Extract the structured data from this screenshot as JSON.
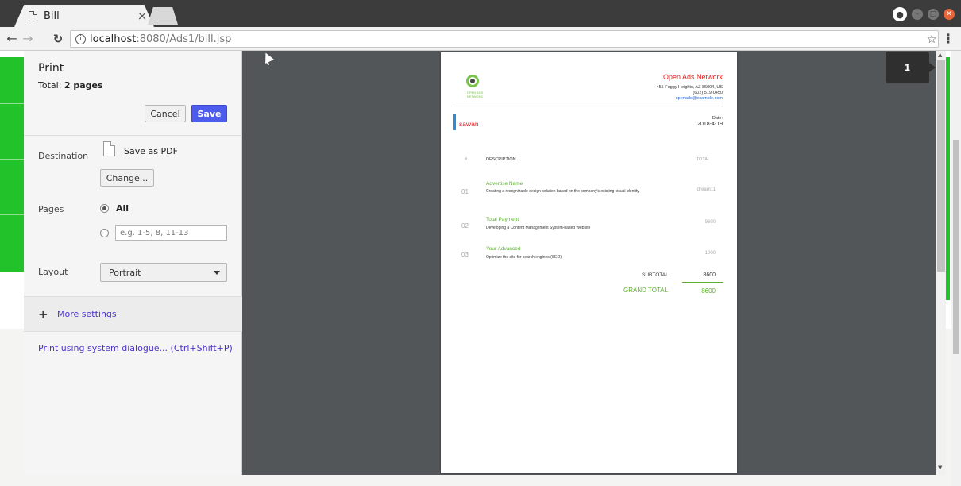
{
  "browser": {
    "tab_title": "Bill",
    "tab_close": "×",
    "url_host": "localhost",
    "url_path": ":8080/Ads1/bill.jsp"
  },
  "print": {
    "title": "Print",
    "total_label": "Total: ",
    "total_value": "2 pages",
    "cancel_label": "Cancel",
    "save_label": "Save",
    "destination_label": "Destination",
    "destination_value": "Save as PDF",
    "change_label": "Change...",
    "pages_label": "Pages",
    "pages_all": "All",
    "pages_placeholder": "e.g. 1-5, 8, 11-13",
    "layout_label": "Layout",
    "layout_value": "Portrait",
    "more_settings": "More settings",
    "system_dialogue": "Print using system dialogue... (Ctrl+Shift+P)",
    "page_indicator": "1"
  },
  "invoice": {
    "logo_text": "OPEN ADS NETWORK",
    "company": "Open Ads Network",
    "address": "455 Foggy Heights, AZ 85004, US",
    "phone": "(602) 519-0450",
    "email": "openads@example.com",
    "client": "sawan",
    "date_label": "Date:",
    "date_value": "2018-4-19",
    "col_num": "#",
    "col_desc": "DESCRIPTION",
    "col_total": "TOTAL",
    "items": [
      {
        "num": "01",
        "title": "Advertise Name",
        "desc": "Creating a recognizable design solution based on the company's existing visual identity",
        "total": "dream11"
      },
      {
        "num": "02",
        "title": "Total Payment",
        "desc": "Developing a Content Management System-based Website",
        "total": "9600"
      },
      {
        "num": "03",
        "title": "Your Advanced",
        "desc": "Optimize the site for search engines (SEO)",
        "total": "1000"
      }
    ],
    "subtotal_label": "SUBTOTAL",
    "subtotal_value": "8600",
    "grand_label": "GRAND TOTAL",
    "grand_value": "8600"
  },
  "colors": {
    "save_button": "#4d5cec",
    "company_red": "#e42121",
    "accent_green": "#5cb02f",
    "preview_bg": "#525659"
  }
}
